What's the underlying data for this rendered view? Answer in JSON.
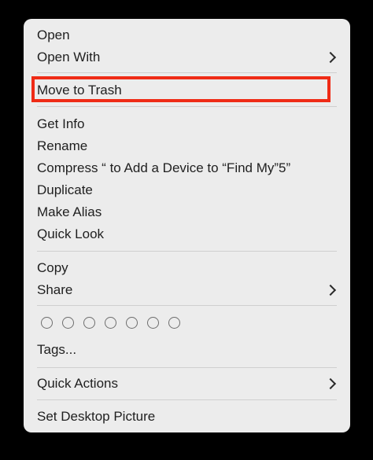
{
  "menu": {
    "groups": [
      {
        "items": [
          {
            "label": "Open",
            "submenu": false
          },
          {
            "label": "Open With",
            "submenu": true
          }
        ]
      },
      {
        "items": [
          {
            "label": "Move to Trash",
            "submenu": false,
            "highlighted": true
          }
        ]
      },
      {
        "items": [
          {
            "label": "Get Info",
            "submenu": false
          },
          {
            "label": "Rename",
            "submenu": false
          },
          {
            "label": "Compress “ to Add a Device to “Find My”5”",
            "submenu": false
          },
          {
            "label": "Duplicate",
            "submenu": false
          },
          {
            "label": "Make Alias",
            "submenu": false
          },
          {
            "label": "Quick Look",
            "submenu": false
          }
        ]
      },
      {
        "items": [
          {
            "label": "Copy",
            "submenu": false
          },
          {
            "label": "Share",
            "submenu": true
          }
        ]
      },
      {
        "tag_colors": 7,
        "items": [
          {
            "label": "Tags...",
            "submenu": false
          }
        ]
      },
      {
        "items": [
          {
            "label": "Quick Actions",
            "submenu": true
          }
        ]
      },
      {
        "items": [
          {
            "label": "Set Desktop Picture",
            "submenu": false
          }
        ]
      }
    ],
    "highlight_color": "#ef2b16",
    "background_color": "#ececec"
  }
}
